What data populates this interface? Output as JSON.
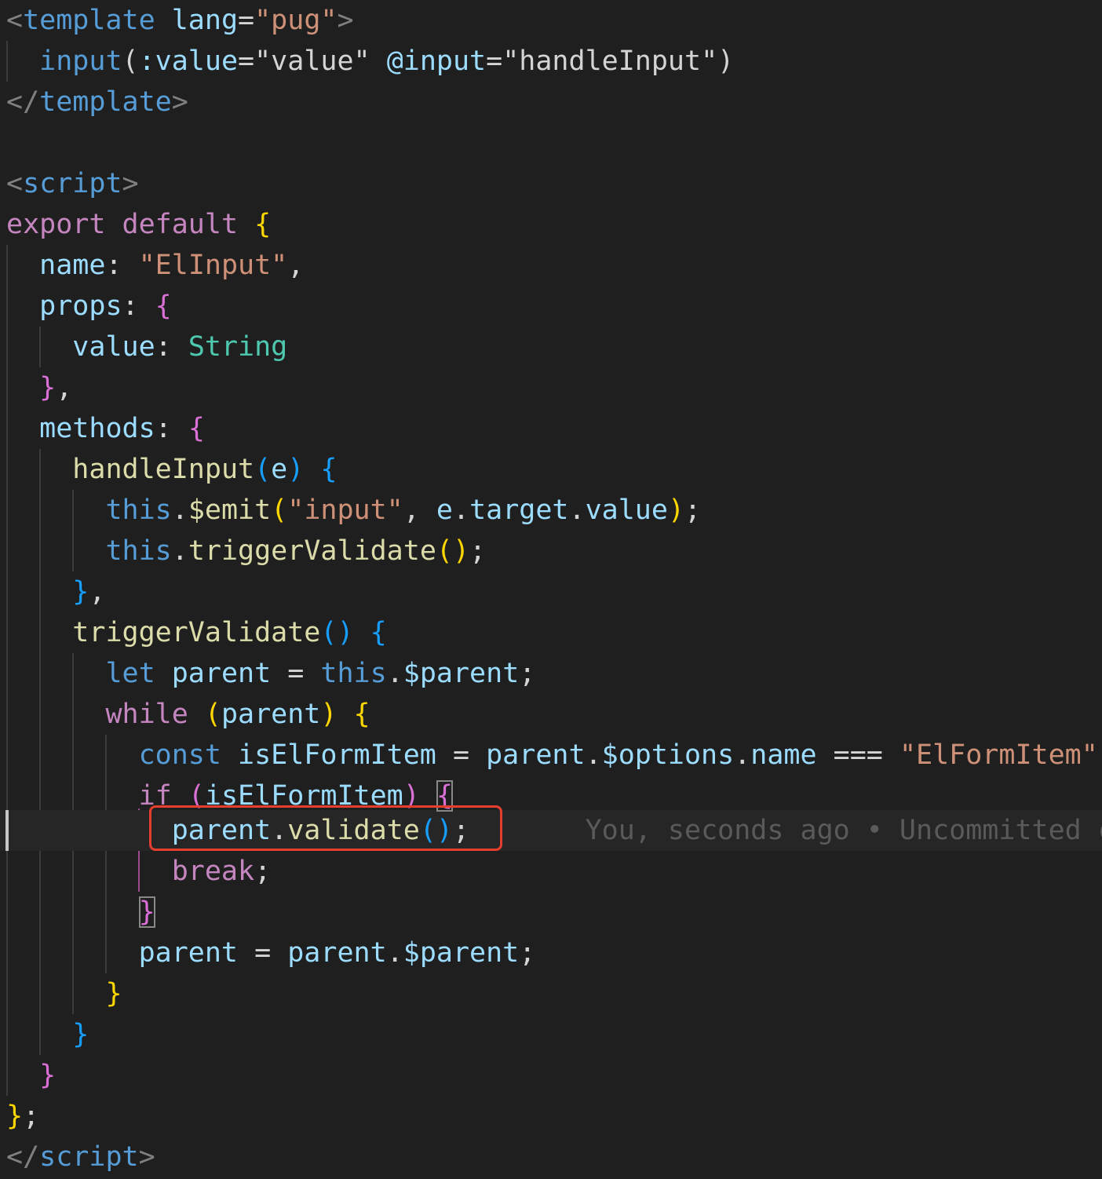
{
  "editor": {
    "blame_annotation": "You, seconds ago • Uncommitted cha",
    "highlight_color": "#e53e2e",
    "lines": {
      "l1": [
        "<",
        "template",
        " ",
        "lang",
        "=",
        "\"pug\"",
        ">"
      ],
      "l2": [
        "input",
        "(",
        ":value",
        "=",
        "\"value\"",
        " ",
        "@input",
        "=",
        "\"handleInput\"",
        ")"
      ],
      "l3": [
        "</",
        "template",
        ">"
      ],
      "l5": [
        "<",
        "script",
        ">"
      ],
      "l6": [
        "export",
        " ",
        "default",
        " ",
        "{"
      ],
      "l7": [
        "name",
        ": ",
        "\"ElInput\"",
        ","
      ],
      "l8": [
        "props",
        ": ",
        "{"
      ],
      "l9": [
        "value",
        ": ",
        "String"
      ],
      "l10": [
        "}",
        ","
      ],
      "l11": [
        "methods",
        ": ",
        "{"
      ],
      "l12": [
        "handleInput",
        "(",
        "e",
        ")",
        " ",
        "{"
      ],
      "l13": [
        "this",
        ".",
        "$emit",
        "(",
        "\"input\"",
        ", ",
        "e",
        ".",
        "target",
        ".",
        "value",
        ")",
        ";"
      ],
      "l14": [
        "this",
        ".",
        "triggerValidate",
        "(",
        ")",
        ";"
      ],
      "l15": [
        "}",
        ","
      ],
      "l16": [
        "triggerValidate",
        "(",
        ")",
        " ",
        "{"
      ],
      "l17": [
        "let",
        " ",
        "parent",
        " = ",
        "this",
        ".",
        "$parent",
        ";"
      ],
      "l18": [
        "while",
        " ",
        "(",
        "parent",
        ")",
        " ",
        "{"
      ],
      "l19": [
        "const",
        " ",
        "isElFormItem",
        " = ",
        "parent",
        ".",
        "$options",
        ".",
        "name",
        " === ",
        "\"ElFormItem\"",
        ";"
      ],
      "l20": [
        "if",
        " ",
        "(",
        "isElFormItem",
        ")",
        " ",
        "{"
      ],
      "l21": [
        "parent",
        ".",
        "validate",
        "(",
        ")",
        ";"
      ],
      "l22": [
        "break",
        ";"
      ],
      "l23": [
        "}"
      ],
      "l24": [
        "parent",
        " = ",
        "parent",
        ".",
        "$parent",
        ";"
      ],
      "l25": [
        "}"
      ],
      "l26": [
        "}"
      ],
      "l27": [
        "}"
      ],
      "l28": [
        "}",
        ";"
      ],
      "l29": [
        "</",
        "script",
        ">"
      ]
    }
  }
}
